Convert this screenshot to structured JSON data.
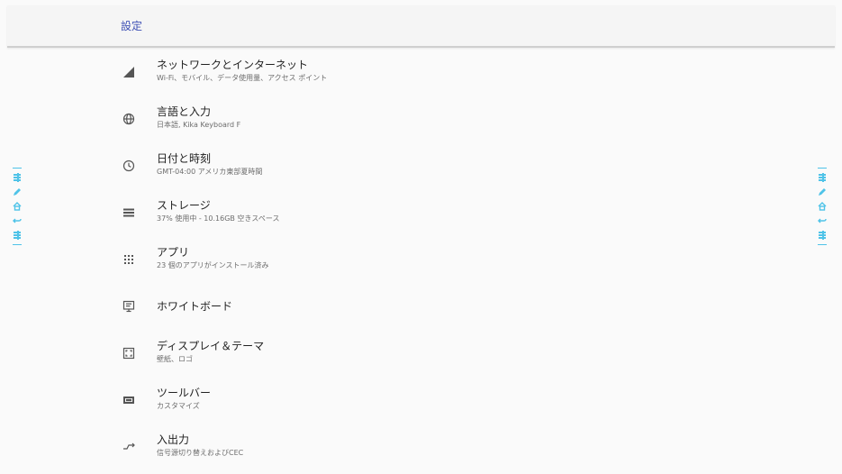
{
  "header": {
    "title": "設定"
  },
  "menu": {
    "items": [
      {
        "icon": "signal-icon",
        "title": "ネットワークとインターネット",
        "subtitle": "Wi-Fi、モバイル、データ使用量、アクセス ポイント"
      },
      {
        "icon": "globe-icon",
        "title": "言語と入力",
        "subtitle": "日本語, Kika Keyboard F"
      },
      {
        "icon": "clock-icon",
        "title": "日付と時刻",
        "subtitle": "GMT-04:00 アメリカ東部夏時間"
      },
      {
        "icon": "storage-icon",
        "title": "ストレージ",
        "subtitle": "37% 使用中 - 10.16GB 空きスペース"
      },
      {
        "icon": "apps-grid-icon",
        "title": "アプリ",
        "subtitle": "23 個のアプリがインストール済み"
      },
      {
        "icon": "whiteboard-icon",
        "title": "ホワイトボード",
        "subtitle": ""
      },
      {
        "icon": "display-icon",
        "title": "ディスプレイ＆テーマ",
        "subtitle": "壁紙、ロゴ"
      },
      {
        "icon": "toolbar-icon",
        "title": "ツールバー",
        "subtitle": "カスタマイズ"
      },
      {
        "icon": "input-output-icon",
        "title": "入出力",
        "subtitle": "信号源切り替えおよびCEC"
      }
    ]
  },
  "colors": {
    "accent": "#3f51b5",
    "sidebar": "#4fc3e8",
    "icon": "#555555"
  }
}
